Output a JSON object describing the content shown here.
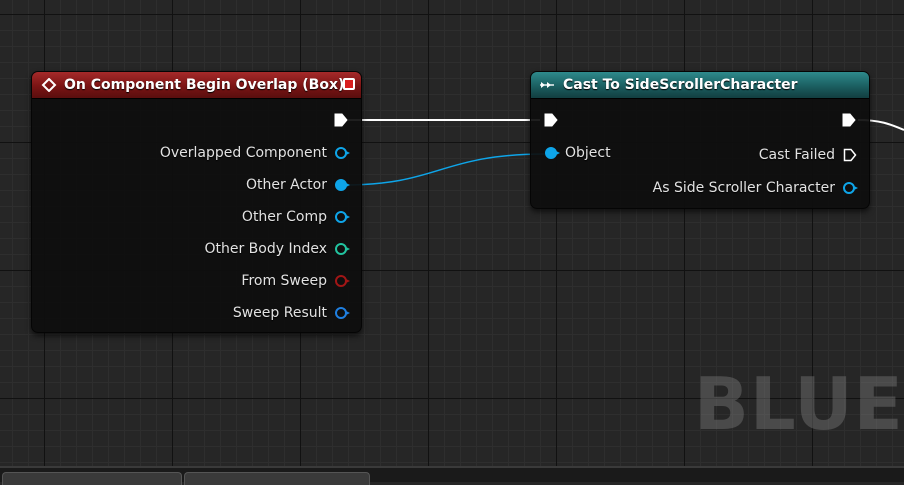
{
  "graph": {
    "watermark": "BLUEP"
  },
  "event_node": {
    "title": "On Component Begin Overlap (Box)",
    "header_color": "#8b1a1a",
    "pins": [
      {
        "label": "Overlapped Component",
        "color": "#0ea5e9"
      },
      {
        "label": "Other Actor",
        "color": "#0ea5e9"
      },
      {
        "label": "Other Comp",
        "color": "#0ea5e9"
      },
      {
        "label": "Other Body Index",
        "color": "#22c4a0"
      },
      {
        "label": "From Sweep",
        "color": "#a11616"
      },
      {
        "label": "Sweep Result",
        "color": "#1f7fe0"
      }
    ]
  },
  "cast_node": {
    "title": "Cast To SideScrollerCharacter",
    "header_color": "#1e6a6c",
    "input_pin": {
      "label": "Object",
      "color": "#0ea5e9"
    },
    "outputs": [
      {
        "label": "Cast Failed"
      },
      {
        "label": "As Side Scroller Character",
        "color": "#0ea5e9"
      }
    ]
  },
  "tabs": [
    "",
    ""
  ]
}
